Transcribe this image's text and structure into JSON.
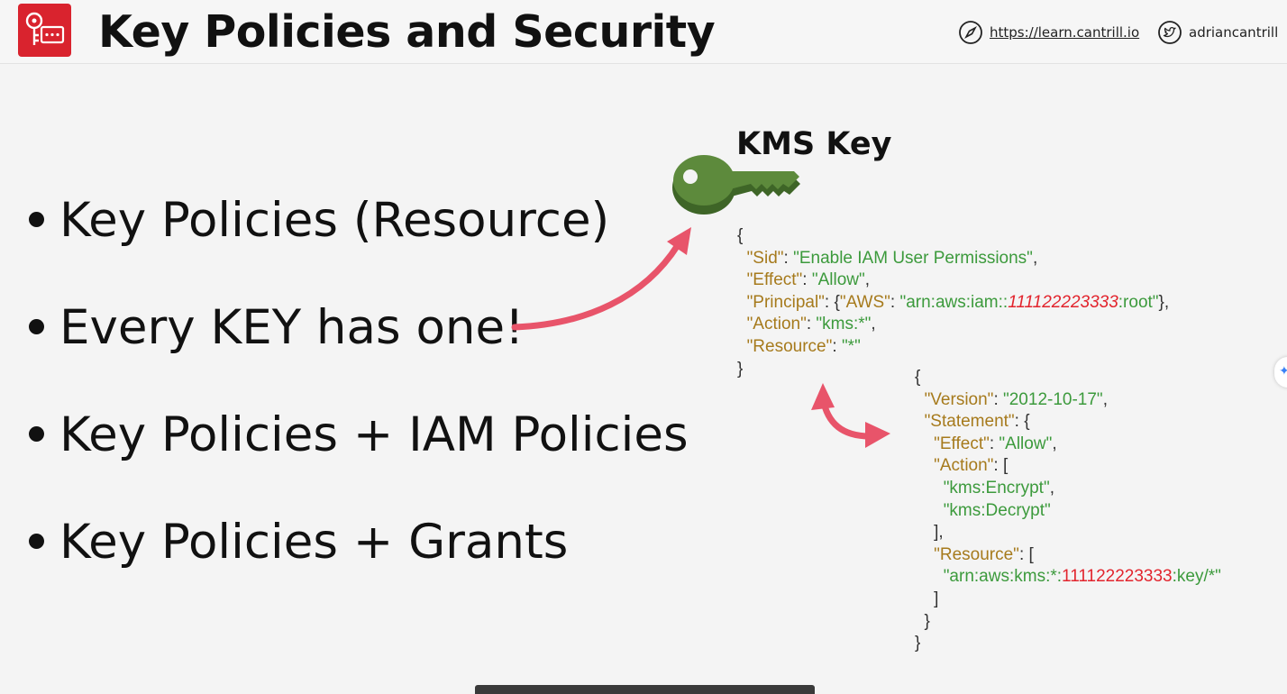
{
  "header": {
    "title": "Key Policies and Security",
    "site_link": "https://learn.cantrill.io",
    "twitter_handle": "adriancantrill",
    "logo_icon": "kms-key-icon",
    "site_icon": "compass-icon",
    "twitter_icon": "twitter-bird-icon"
  },
  "bullets": [
    "Key Policies (Resource)",
    "Every KEY has one!",
    "Key Policies + IAM Policies",
    "Key Policies + Grants"
  ],
  "diagram": {
    "kms_title": "KMS Key",
    "key_icon": "key-icon",
    "key_color": "#5d8a3c",
    "arrow_color": "#e8546a",
    "key_policy": {
      "sid_key": "\"Sid\"",
      "sid_value": "\"Enable IAM User Permissions\"",
      "effect_key": "\"Effect\"",
      "effect_value": "\"Allow\"",
      "principal_key": "\"Principal\"",
      "aws_key": "\"AWS\"",
      "arn_prefix": "\"arn:aws:iam::",
      "account_id": "111122223333",
      "arn_suffix": ":root\"",
      "action_key": "\"Action\"",
      "action_value": "\"kms:*\"",
      "resource_key": "\"Resource\"",
      "resource_value": "\"*\""
    },
    "iam_policy": {
      "version_key": "\"Version\"",
      "version_value": "\"2012-10-17\"",
      "statement_key": "\"Statement\"",
      "effect_key": "\"Effect\"",
      "effect_value": "\"Allow\"",
      "action_key": "\"Action\"",
      "action_1": "\"kms:Encrypt\"",
      "action_2": "\"kms:Decrypt\"",
      "resource_key": "\"Resource\"",
      "resource_prefix": "\"arn:aws:kms:*:",
      "account_id": "111122223333",
      "resource_suffix": ":key/*\""
    }
  },
  "colors": {
    "brand_red": "#d9232e",
    "json_key": "#a67a1c",
    "json_string": "#3c9a3c",
    "account_id": "#e2242d"
  }
}
